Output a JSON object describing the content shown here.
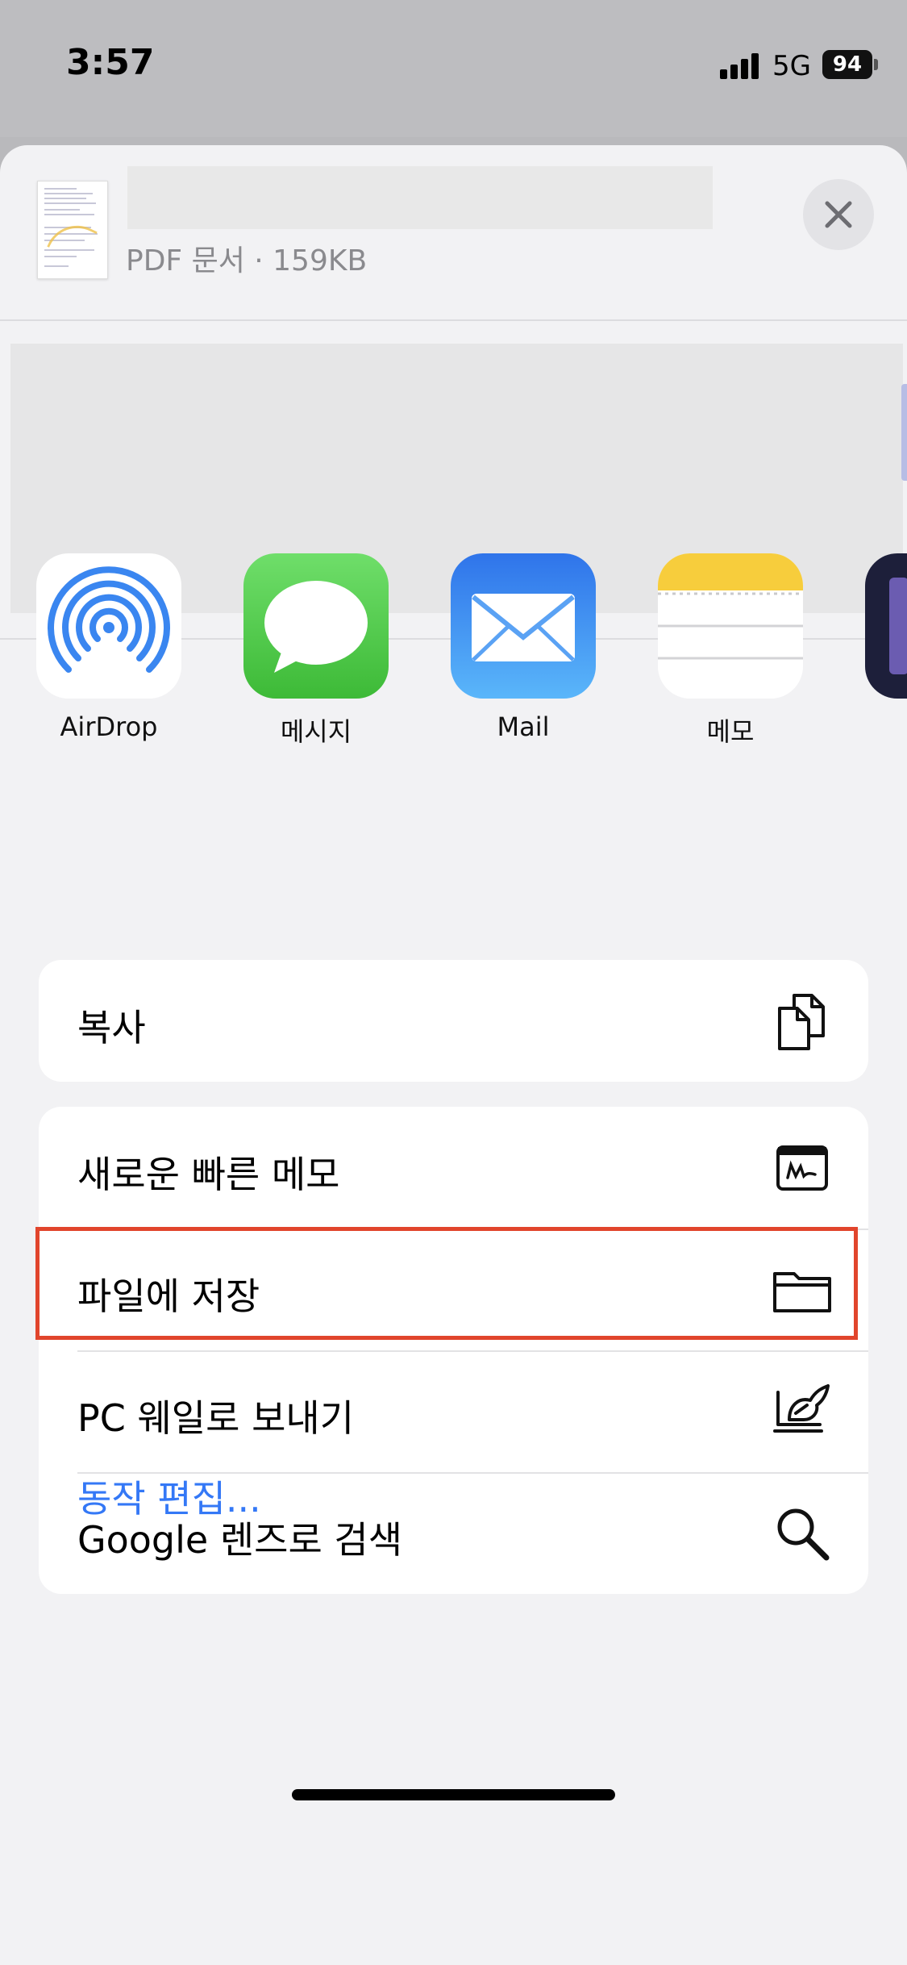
{
  "status_bar": {
    "time": "3:57",
    "network": "5G",
    "battery": "94"
  },
  "share_sheet": {
    "file_subtitle": "PDF 문서 · 159KB",
    "close_icon": "xmark-icon"
  },
  "apps": [
    {
      "label": "AirDrop",
      "icon": "airdrop-icon"
    },
    {
      "label": "메시지",
      "icon": "messages-icon"
    },
    {
      "label": "Mail",
      "icon": "mail-icon"
    },
    {
      "label": "메모",
      "icon": "notes-icon"
    }
  ],
  "actions": {
    "copy": {
      "label": "복사",
      "icon": "copy-icon"
    },
    "quick_note": {
      "label": "새로운 빠른 메모",
      "icon": "quick-note-icon"
    },
    "save_to_files": {
      "label": "파일에 저장",
      "icon": "folder-icon"
    },
    "pc_whale": {
      "label": "PC 웨일로 보내기",
      "icon": "whale-icon"
    },
    "google_lens": {
      "label": "Google 렌즈로 검색",
      "icon": "magnifier-icon"
    }
  },
  "edit_actions_label": "동작 편집...",
  "colors": {
    "link": "#3478f6",
    "highlight": "#e1452c"
  }
}
